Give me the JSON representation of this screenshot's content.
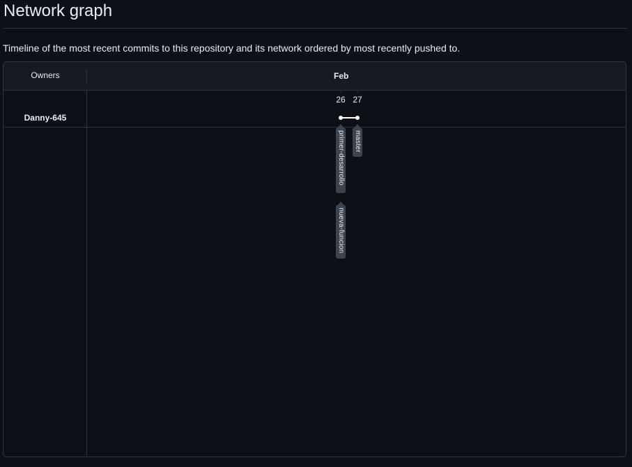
{
  "page": {
    "title": "Network graph",
    "description": "Timeline of the most recent commits to this repository and its network ordered by most recently pushed to."
  },
  "graph": {
    "owners_header": "Owners",
    "month_label": "Feb",
    "days": [
      "26",
      "27"
    ],
    "owners": [
      {
        "name": "Danny-645"
      }
    ],
    "branches": [
      {
        "name": "primer-desarrollo"
      },
      {
        "name": "nueva-funcion"
      },
      {
        "name": "master"
      }
    ],
    "colors": {
      "background": "#0d1117",
      "header_background": "#161b22",
      "border": "#30363d",
      "commit": "#ffffff",
      "label_background": "#3d444d"
    }
  }
}
